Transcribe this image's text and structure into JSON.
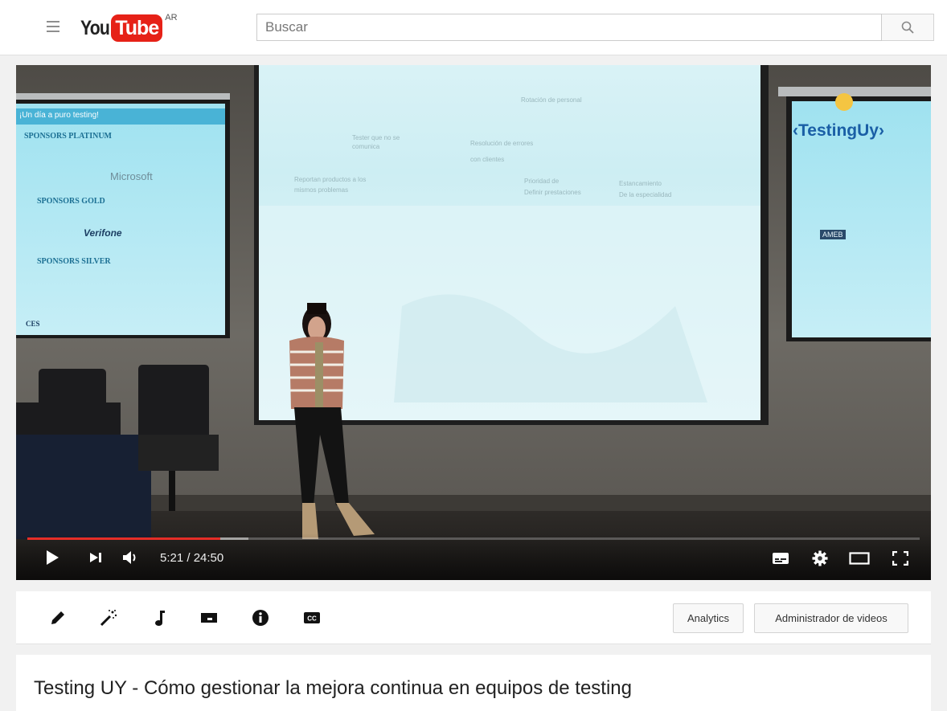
{
  "header": {
    "logo_you": "You",
    "logo_tube": "Tube",
    "country_code": "AR",
    "search_placeholder": "Buscar",
    "search_icon": "magnifier-icon",
    "menu_icon": "hamburger-icon"
  },
  "player": {
    "time_display": "5:21 / 24:50",
    "progress_played_fraction": 0.216,
    "progress_buffered_fraction": 0.248,
    "accent_color": "#e52d27",
    "controls": [
      "play-icon",
      "next-icon",
      "volume-icon",
      "subtitles-icon",
      "settings-gear-icon",
      "theater-mode-icon",
      "fullscreen-icon"
    ],
    "scene": {
      "left_screen": {
        "header": "¡Un día a puro testing!",
        "platinum": "SPONSORS PLATINUM",
        "platinum_logo": "Microsoft",
        "gold": "SPONSORS GOLD",
        "gold_logo": "Verifone",
        "silver": "SPONSORS SILVER",
        "footer_logo": "CES"
      },
      "right_screen": {
        "brand": "‹TestingUy›",
        "badge": "AMEB"
      }
    }
  },
  "toolbar": {
    "tools": [
      "pencil-icon",
      "magic-wand-icon",
      "music-note-icon",
      "annotations-icon",
      "info-icon",
      "cc-icon"
    ],
    "analytics_label": "Analytics",
    "video_manager_label": "Administrador de videos"
  },
  "video": {
    "title": "Testing UY - Cómo gestionar la mejora continua en equipos de testing"
  },
  "colors": {
    "brand_red": "#e62117",
    "page_bg": "#f1f1f1"
  }
}
